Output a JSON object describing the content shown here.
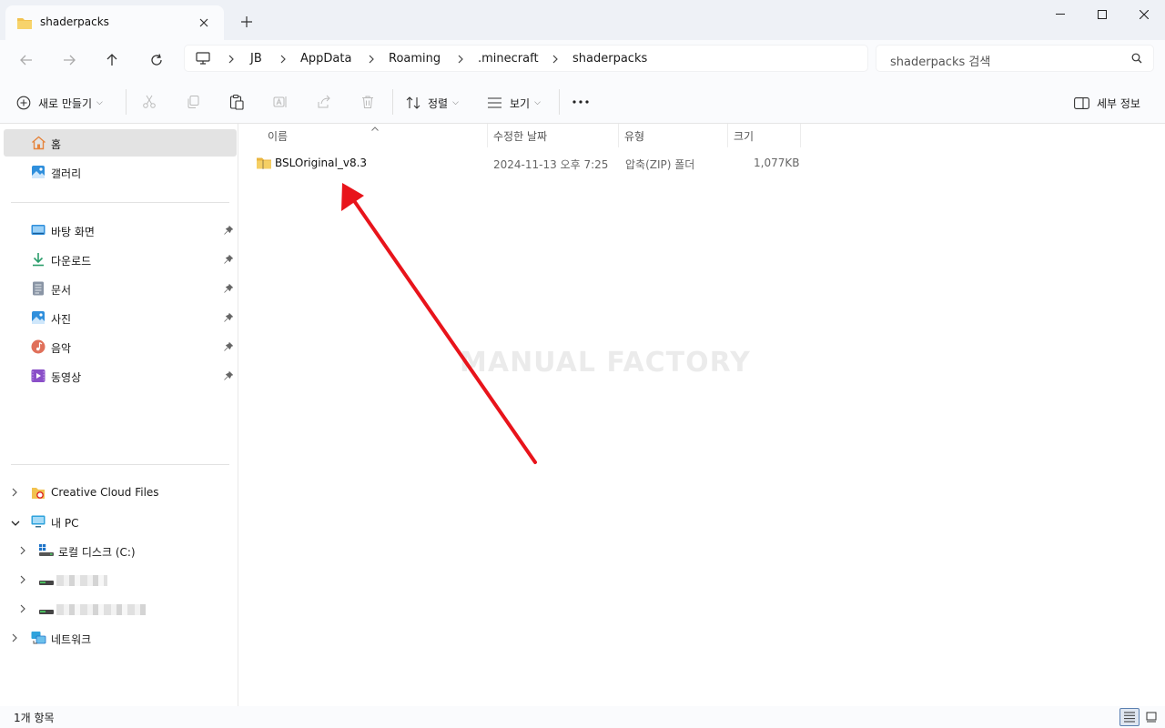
{
  "window": {
    "tab_title": "shaderpacks",
    "tab_icon": "folder-icon",
    "new_tab": "+"
  },
  "address": {
    "segments": [
      "JB",
      "AppData",
      "Roaming",
      ".minecraft",
      "shaderpacks"
    ],
    "search_placeholder": "shaderpacks 검색"
  },
  "toolbar": {
    "new_label": "새로 만들기",
    "sort_label": "정렬",
    "view_label": "보기",
    "details_label": "세부 정보"
  },
  "sidebar": {
    "home": "홈",
    "gallery": "갤러리",
    "quick": [
      {
        "label": "바탕 화면",
        "icon": "desktop-icon"
      },
      {
        "label": "다운로드",
        "icon": "download-icon"
      },
      {
        "label": "문서",
        "icon": "documents-icon"
      },
      {
        "label": "사진",
        "icon": "pictures-icon"
      },
      {
        "label": "음악",
        "icon": "music-icon"
      },
      {
        "label": "동영상",
        "icon": "videos-icon"
      }
    ],
    "tree": {
      "creative_cloud": "Creative Cloud Files",
      "this_pc": "내 PC",
      "local_disk": "로컬 디스크 (C:)",
      "network": "네트워크"
    }
  },
  "columns": {
    "name": "이름",
    "modified": "수정한 날짜",
    "type": "유형",
    "size": "크기"
  },
  "files": [
    {
      "name": "BSLOriginal_v8.3",
      "modified": "2024-11-13 오후 7:25",
      "type": "압축(ZIP) 폴더",
      "size": "1,077KB"
    }
  ],
  "watermark": "MANUAL FACTORY",
  "status": {
    "item_count": "1개 항목"
  },
  "colors": {
    "arrow": "#e8141b",
    "folder": "#f2c24f",
    "selected": "#e3e3e3"
  }
}
